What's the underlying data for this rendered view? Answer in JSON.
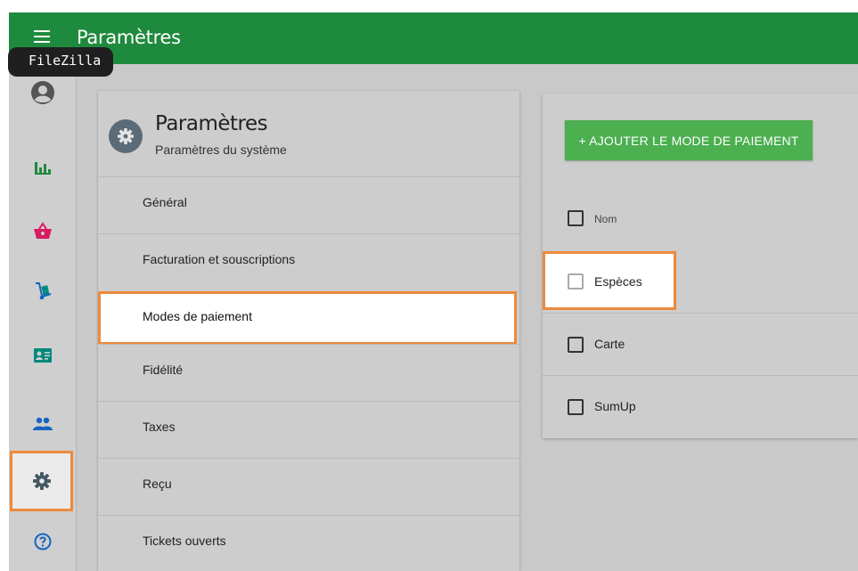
{
  "header": {
    "title": "Paramètres",
    "menu_icon": "hamburger-menu-icon"
  },
  "tooltip": {
    "text": "FileZilla"
  },
  "rail": {
    "items": [
      {
        "name": "account",
        "icon": "account-circle-icon"
      },
      {
        "name": "reports",
        "icon": "bar-chart-icon"
      },
      {
        "name": "sales",
        "icon": "basket-icon"
      },
      {
        "name": "inventory",
        "icon": "hand-truck-icon"
      },
      {
        "name": "customers",
        "icon": "contact-card-icon"
      },
      {
        "name": "employees",
        "icon": "people-icon"
      },
      {
        "name": "settings",
        "icon": "gear-icon",
        "active": true
      },
      {
        "name": "help",
        "icon": "help-circle-icon"
      }
    ],
    "colors": {
      "green": "#1e8a3e",
      "pink": "#d81b60",
      "teal": "#00897b",
      "blue": "#1565c0",
      "dark": "#37474f"
    }
  },
  "settings": {
    "title": "Paramètres",
    "subtitle": "Paramètres du système",
    "items": [
      {
        "label": "Général"
      },
      {
        "label": "Facturation et souscriptions"
      },
      {
        "label": "Modes de paiement",
        "selected": true
      },
      {
        "label": "Fidélité"
      },
      {
        "label": "Taxes"
      },
      {
        "label": "Reçu"
      },
      {
        "label": "Tickets ouverts"
      }
    ]
  },
  "payment_methods": {
    "add_button": "+ AJOUTER LE MODE DE PAIEMENT",
    "column_header": "Nom",
    "rows": [
      {
        "name": "Espèces",
        "highlighted": true
      },
      {
        "name": "Carte"
      },
      {
        "name": "SumUp"
      }
    ]
  },
  "colors": {
    "topbar": "#1e8a3e",
    "highlight": "#ee8a3a",
    "button": "#4caf50"
  }
}
